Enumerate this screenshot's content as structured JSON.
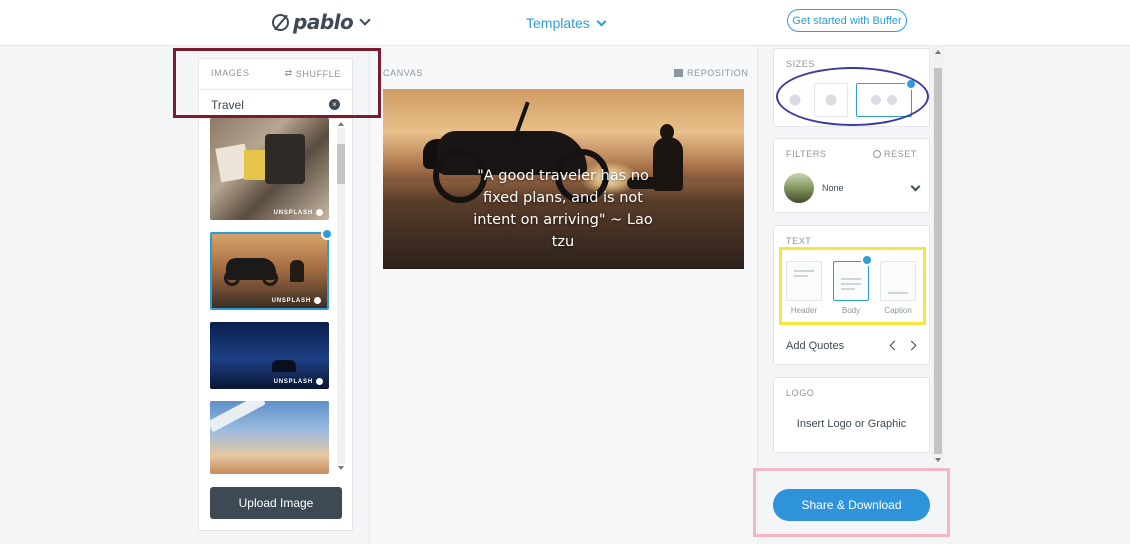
{
  "header": {
    "brand": "pablo",
    "templates_label": "Templates",
    "cta_label": "Get started with Buffer"
  },
  "images_panel": {
    "title": "IMAGES",
    "shuffle_label": "SHUFFLE",
    "search_value": "Travel",
    "clear_icon": "×",
    "credit": "UNSPLASH",
    "upload_label": "Upload Image"
  },
  "canvas": {
    "label": "CANVAS",
    "reposition_label": "REPOSITION",
    "quote_text": "\"A good traveler has no fixed plans, and is not intent on arriving\" ~ Lao tzu"
  },
  "sizes": {
    "label": "SIZES"
  },
  "filters": {
    "label": "FILTERS",
    "reset_label": "RESET",
    "selected": "None"
  },
  "text": {
    "label": "TEXT",
    "options": [
      "Header",
      "Body",
      "Caption"
    ],
    "add_quotes_label": "Add Quotes"
  },
  "logo": {
    "label": "LOGO",
    "cta": "Insert Logo or Graphic"
  },
  "share_label": "Share & Download",
  "colors": {
    "accent": "#2d9cdb",
    "dark": "#3d4a55"
  }
}
